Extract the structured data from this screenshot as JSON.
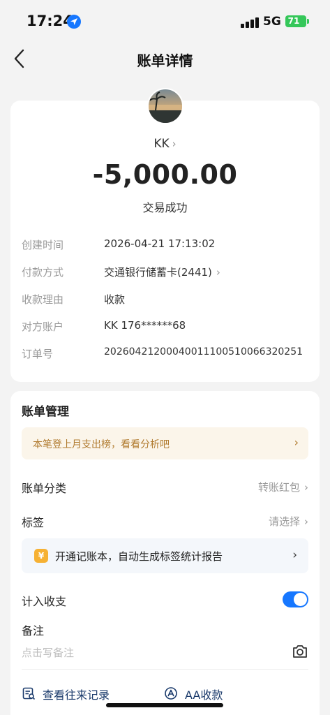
{
  "status_bar": {
    "time": "17:24",
    "network": "5G",
    "battery": "71"
  },
  "nav": {
    "title": "账单详情",
    "back_icon": "chevron-left-icon"
  },
  "transaction": {
    "payee": "KK",
    "amount": "-5,000.00",
    "status": "交易成功"
  },
  "details": {
    "created_label": "创建时间",
    "created_value": "2026-04-21 17:13:02",
    "payment_label": "付款方式",
    "payment_value": "交通银行储蓄卡(2441)",
    "reason_label": "收款理由",
    "reason_value": "收款",
    "account_label": "对方账户",
    "account_value": "KK 176******68",
    "order_label": "订单号",
    "order_value": "20260421200040011100510066320251"
  },
  "management": {
    "title": "账单管理",
    "tip": "本笔登上月支出榜，看看分析吧",
    "category_label": "账单分类",
    "category_value": "转账红包",
    "tag_label": "标签",
    "tag_value": "请选择",
    "promo_icon_char": "¥",
    "promo_text": "开通记账本，自动生成标签统计报告",
    "count_label": "计入收支",
    "count_enabled": true,
    "remark_label": "备注",
    "remark_placeholder": "点击写备注",
    "history_label": "查看往来记录",
    "aa_label": "AA收款"
  },
  "colors": {
    "accent": "#1677ff",
    "tip_text": "#b07a2e",
    "tip_bg": "#fbf5ea",
    "link_text": "#1a3a6b"
  }
}
